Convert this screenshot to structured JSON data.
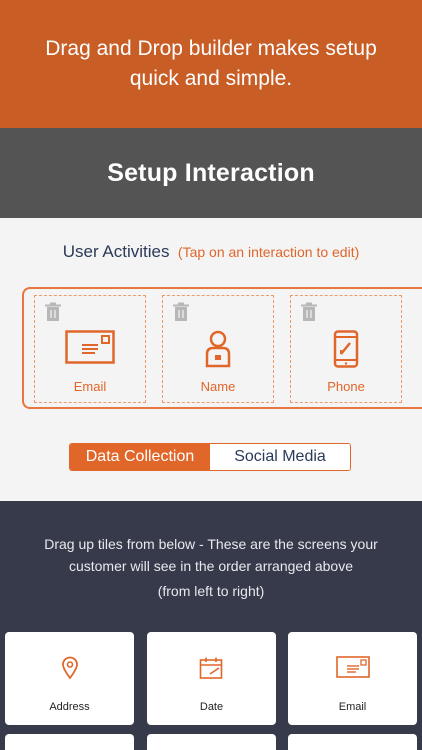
{
  "banner": {
    "text": "Drag and Drop builder makes setup quick and simple."
  },
  "header": {
    "title": "Setup Interaction"
  },
  "activities": {
    "label": "User Activities",
    "hint": "(Tap on an interaction to edit)",
    "items": [
      {
        "label": "Email",
        "icon": "envelope-icon"
      },
      {
        "label": "Name",
        "icon": "person-icon"
      },
      {
        "label": "Phone",
        "icon": "phone-icon"
      }
    ]
  },
  "segments": {
    "active": "Data Collection",
    "inactive": "Social Media"
  },
  "tiles_panel": {
    "instruction_line1": "Drag up tiles from below - These are the screens your",
    "instruction_line2": "customer will see in the order arranged above",
    "instruction_line3": "(from left to right)",
    "tiles": [
      {
        "label": "Address",
        "icon": "location-pin-icon"
      },
      {
        "label": "Date",
        "icon": "calendar-icon"
      },
      {
        "label": "Email",
        "icon": "envelope-icon"
      }
    ]
  },
  "colors": {
    "accent": "#e0662a",
    "banner": "#c85d26",
    "header": "#545454",
    "panel": "#363a4a",
    "navy": "#2b3a58"
  }
}
